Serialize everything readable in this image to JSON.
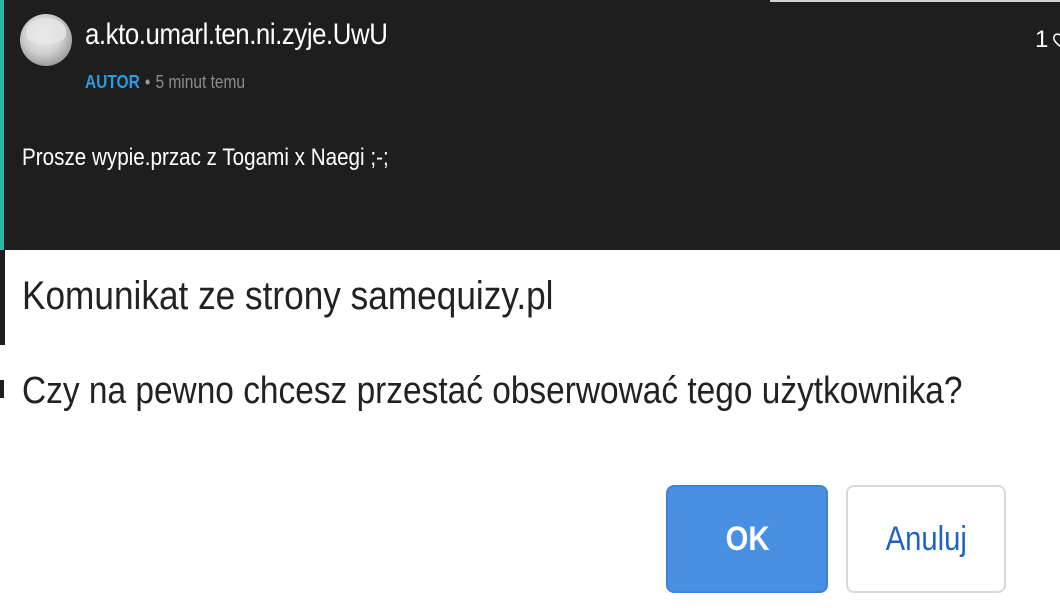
{
  "comment": {
    "username": "a.kto.umarl.ten.ni.zyje.UwU",
    "role_badge": "AUTOR",
    "separator": "•",
    "time": "5 minut temu",
    "likes_count": "1",
    "like_icon": "heart-outline-icon",
    "body": "Prosze wypie.przac z Togami x Naegi ;-;",
    "accent_color": "#2bb8a6",
    "role_color": "#2d9be0"
  },
  "dialog": {
    "title": "Komunikat ze strony samequizy.pl",
    "message": "Czy na pewno chcesz przestać obserwować tego użytkownika?",
    "ok_label": "OK",
    "cancel_label": "Anuluj",
    "ok_color": "#4a90e2"
  }
}
